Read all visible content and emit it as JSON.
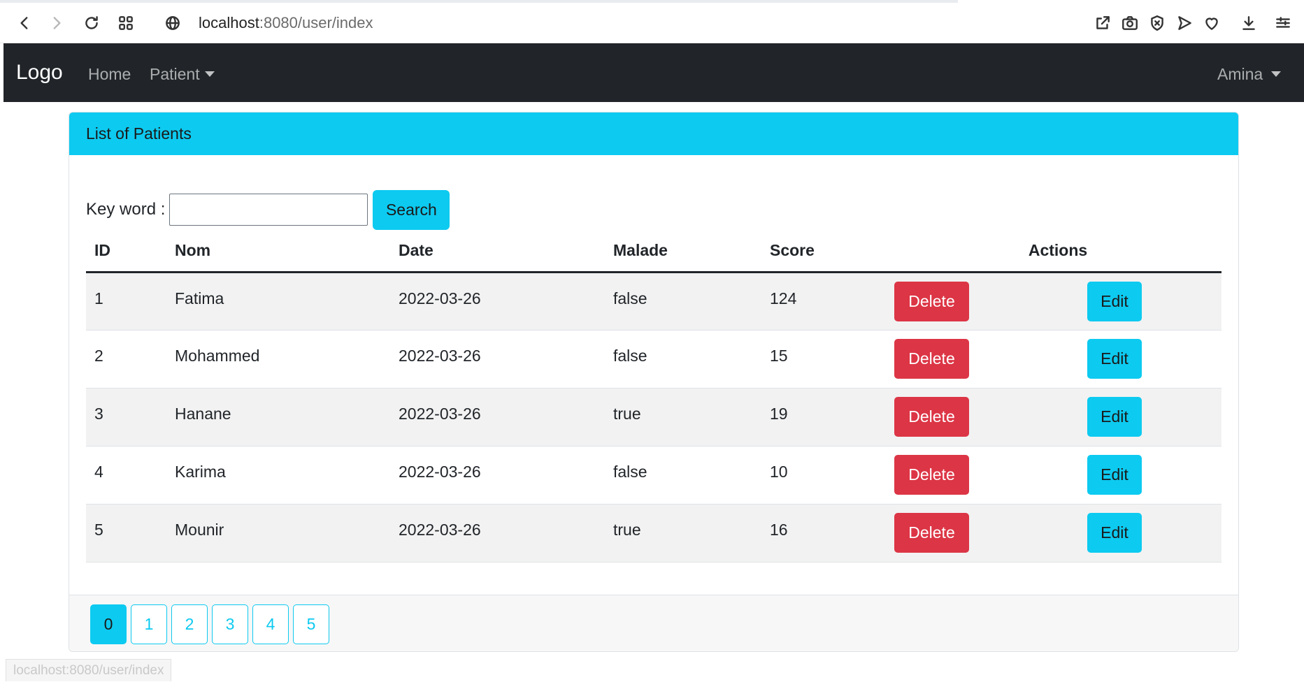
{
  "browser": {
    "url_host": "localhost",
    "url_path": ":8080/user/index",
    "status_url": "localhost:8080/user/index",
    "icons": [
      "back-icon",
      "forward-icon",
      "reload-icon",
      "apps-grid-icon",
      "globe-icon",
      "share-icon",
      "camera-icon",
      "shield-icon",
      "send-icon",
      "heart-icon",
      "download-icon",
      "menu-icon"
    ]
  },
  "navbar": {
    "brand": "Logo",
    "links": [
      {
        "label": "Home"
      },
      {
        "label": "Patient"
      }
    ],
    "user": "Amina"
  },
  "card": {
    "title": "List of Patients",
    "search_label": "Key word :",
    "search_value": "",
    "search_button": "Search"
  },
  "table": {
    "headers": [
      "ID",
      "Nom",
      "Date",
      "Malade",
      "Score",
      "Actions"
    ],
    "rows": [
      {
        "id": "1",
        "nom": "Fatima",
        "date": "2022-03-26",
        "malade": "false",
        "score": "124"
      },
      {
        "id": "2",
        "nom": "Mohammed",
        "date": "2022-03-26",
        "malade": "false",
        "score": "15"
      },
      {
        "id": "3",
        "nom": "Hanane",
        "date": "2022-03-26",
        "malade": "true",
        "score": "19"
      },
      {
        "id": "4",
        "nom": "Karima",
        "date": "2022-03-26",
        "malade": "false",
        "score": "10"
      },
      {
        "id": "5",
        "nom": "Mounir",
        "date": "2022-03-26",
        "malade": "true",
        "score": "16"
      }
    ],
    "delete_label": "Delete",
    "edit_label": "Edit"
  },
  "pagination": {
    "pages": [
      "0",
      "1",
      "2",
      "3",
      "4",
      "5"
    ],
    "current": "0"
  },
  "colors": {
    "navbar": "#212529",
    "info": "#0dcaf0",
    "danger": "#dc3545"
  }
}
